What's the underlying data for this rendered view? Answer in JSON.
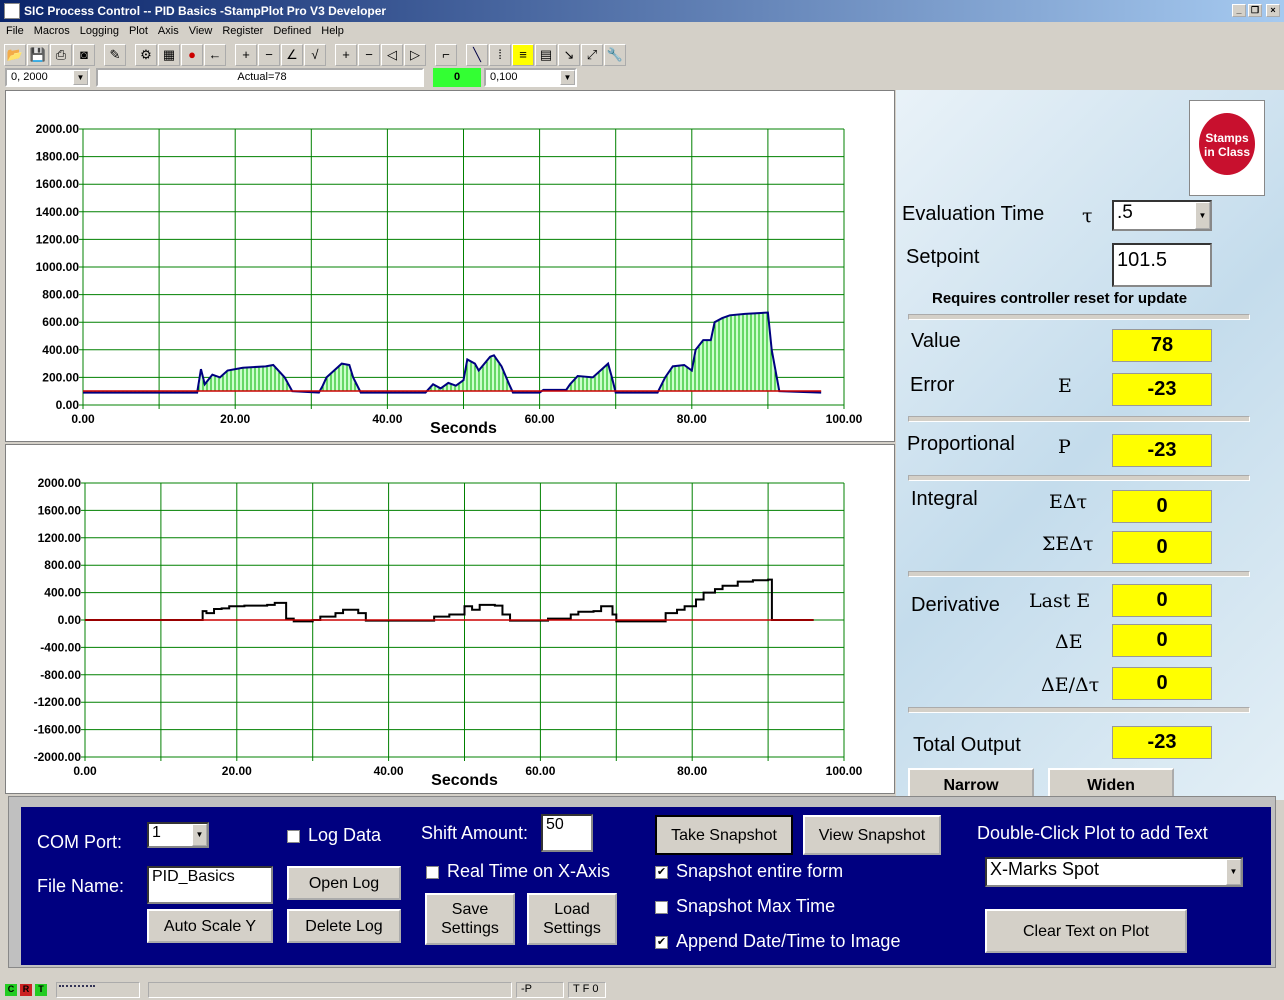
{
  "window": {
    "title": "SIC Process Control -- PID Basics -StampPlot Pro V3 Developer"
  },
  "menu": [
    "File",
    "Macros",
    "Logging",
    "Plot",
    "Axis",
    "View",
    "Register",
    "Defined",
    "Help"
  ],
  "toolbar": {
    "yrange": "0, 2000",
    "status": "Actual=78",
    "indicator": "0",
    "indicator_color": "#33ff33",
    "xrange": "0,100"
  },
  "chart_data": [
    {
      "type": "line",
      "xlabel": "Seconds",
      "xlim": [
        0,
        100
      ],
      "ylim": [
        0,
        2000
      ],
      "grid": true,
      "xticks": [
        "0.00",
        "20.00",
        "40.00",
        "60.00",
        "80.00",
        "100.00"
      ],
      "yticks": [
        "0.00",
        "200.00",
        "400.00",
        "600.00",
        "800.00",
        "1000.00",
        "1200.00",
        "1400.00",
        "1600.00",
        "1800.00",
        "2000.00"
      ],
      "series": [
        {
          "color": "#000080",
          "fill": "#00cc00",
          "x": [
            0,
            15,
            15.5,
            16,
            17,
            18,
            19,
            21,
            24,
            25,
            26.5,
            27.5,
            31,
            31.5,
            32,
            33,
            34,
            35,
            35.5,
            36.5,
            45,
            46,
            47,
            48,
            49,
            50,
            50.5,
            51.5,
            52,
            53.5,
            54,
            55,
            56,
            56.5,
            60,
            60.5,
            63.5,
            64,
            65,
            67,
            68,
            69,
            69.5,
            70,
            75.5,
            76.5,
            77.5,
            79,
            80,
            80.5,
            81.5,
            82.5,
            83,
            84,
            85,
            87,
            90,
            90.5,
            91.5,
            97
          ],
          "y": [
            90,
            90,
            260,
            150,
            220,
            200,
            250,
            270,
            280,
            290,
            200,
            100,
            90,
            140,
            200,
            250,
            300,
            290,
            200,
            90,
            90,
            150,
            120,
            160,
            140,
            180,
            330,
            300,
            250,
            350,
            360,
            280,
            150,
            90,
            90,
            110,
            110,
            150,
            210,
            200,
            250,
            300,
            200,
            90,
            90,
            200,
            280,
            290,
            250,
            400,
            470,
            470,
            600,
            630,
            650,
            660,
            670,
            400,
            100,
            90
          ]
        },
        {
          "color": "#cc0000",
          "x": [
            0,
            97
          ],
          "y": [
            101.5,
            101.5
          ]
        }
      ]
    },
    {
      "type": "line",
      "xlabel": "Seconds",
      "xlim": [
        0,
        100
      ],
      "ylim": [
        -2000,
        2000
      ],
      "grid": true,
      "xticks": [
        "0.00",
        "20.00",
        "40.00",
        "60.00",
        "80.00",
        "100.00"
      ],
      "yticks": [
        "-2000.00",
        "-1600.00",
        "-1200.00",
        "-800.00",
        "-400.00",
        "0.00",
        "400.00",
        "800.00",
        "1200.00",
        "1600.00",
        "2000.00"
      ],
      "series": [
        {
          "color": "#000000",
          "step": true,
          "x": [
            0,
            15,
            15.5,
            16,
            17,
            18,
            19,
            21,
            24,
            25,
            26.5,
            27.5,
            30,
            31,
            33,
            34,
            36,
            37,
            45,
            46,
            48,
            50,
            51,
            52,
            54,
            55,
            56,
            60,
            61,
            63.5,
            64,
            65,
            67,
            68,
            69.5,
            70,
            75,
            76.5,
            78,
            79,
            80.5,
            81.5,
            83,
            84,
            86,
            88,
            90,
            90.5,
            96
          ],
          "y": [
            0,
            0,
            130,
            100,
            160,
            170,
            200,
            210,
            220,
            250,
            20,
            -20,
            0,
            50,
            100,
            150,
            100,
            -10,
            -10,
            50,
            80,
            200,
            150,
            220,
            210,
            80,
            -10,
            -10,
            20,
            20,
            80,
            120,
            130,
            200,
            80,
            -20,
            -20,
            100,
            150,
            200,
            300,
            400,
            450,
            500,
            560,
            580,
            590,
            0,
            0
          ]
        },
        {
          "color": "#cc0000",
          "x": [
            0,
            96
          ],
          "y": [
            0,
            0
          ]
        }
      ]
    }
  ],
  "panel": {
    "eval_time_label": "Evaluation Time",
    "tau": "τ",
    "eval_time_value": ".5",
    "setpoint_label": "Setpoint",
    "setpoint_value": "101.5",
    "note": "Requires controller reset for update",
    "value_label": "Value",
    "value": "78",
    "error_label": "Error",
    "error_sym": "E",
    "error": "-23",
    "prop_label": "Proportional",
    "prop_sym": "P",
    "prop": "-23",
    "int_label": "Integral",
    "int_sym1": "EΔτ",
    "int1": "0",
    "int_sym2": "ΣEΔτ",
    "int2": "0",
    "der_label": "Derivative",
    "der_sym1": "Last E",
    "der1": "0",
    "der_sym2": "ΔE",
    "der2": "0",
    "der_sym3": "ΔE/Δτ",
    "der3": "0",
    "total_label": "Total Output",
    "total": "-23",
    "narrow": "Narrow",
    "widen": "Widen",
    "logo": "Stamps in Class"
  },
  "controls": {
    "com_label": "COM Port:",
    "com_value": "1",
    "file_label": "File Name:",
    "file_value": "PID_Basics",
    "log_data": "Log Data",
    "open_log": "Open Log",
    "delete_log": "Delete Log",
    "auto_scale": "Auto Scale Y",
    "shift_label": "Shift Amount:",
    "shift_value": "50",
    "real_time": "Real Time on X-Axis",
    "save_settings": "Save Settings",
    "load_settings": "Load Settings",
    "take_snapshot": "Take Snapshot",
    "view_snapshot": "View Snapshot",
    "snap_form": "Snapshot entire form",
    "snap_max": "Snapshot Max Time",
    "append_date": "Append Date/Time to Image",
    "dbl_click": "Double-Click Plot to add Text",
    "text_select": "X-Marks Spot",
    "clear_text": "Clear Text on Plot",
    "checks": {
      "log_data": false,
      "real_time": false,
      "snap_form": true,
      "snap_max": false,
      "append_date": true
    }
  },
  "statusbar": {
    "c": "C",
    "r": "R",
    "t": "T",
    "p": "-P",
    "tfo": "T F 0"
  }
}
